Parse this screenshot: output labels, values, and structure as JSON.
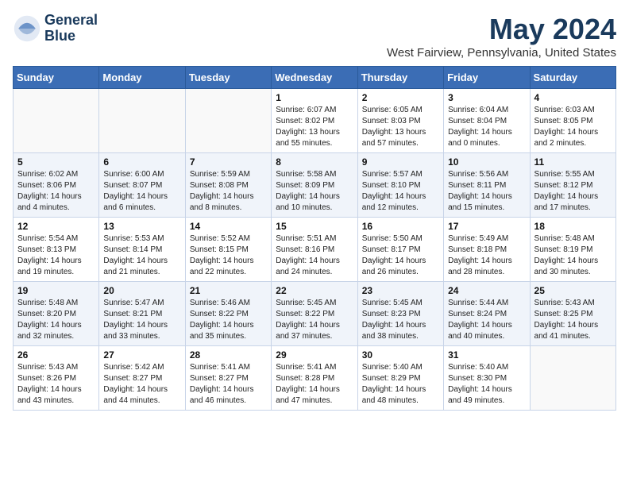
{
  "header": {
    "logo_line1": "General",
    "logo_line2": "Blue",
    "month_year": "May 2024",
    "location": "West Fairview, Pennsylvania, United States"
  },
  "days_of_week": [
    "Sunday",
    "Monday",
    "Tuesday",
    "Wednesday",
    "Thursday",
    "Friday",
    "Saturday"
  ],
  "weeks": [
    [
      {
        "day": "",
        "info": ""
      },
      {
        "day": "",
        "info": ""
      },
      {
        "day": "",
        "info": ""
      },
      {
        "day": "1",
        "info": "Sunrise: 6:07 AM\nSunset: 8:02 PM\nDaylight: 13 hours\nand 55 minutes."
      },
      {
        "day": "2",
        "info": "Sunrise: 6:05 AM\nSunset: 8:03 PM\nDaylight: 13 hours\nand 57 minutes."
      },
      {
        "day": "3",
        "info": "Sunrise: 6:04 AM\nSunset: 8:04 PM\nDaylight: 14 hours\nand 0 minutes."
      },
      {
        "day": "4",
        "info": "Sunrise: 6:03 AM\nSunset: 8:05 PM\nDaylight: 14 hours\nand 2 minutes."
      }
    ],
    [
      {
        "day": "5",
        "info": "Sunrise: 6:02 AM\nSunset: 8:06 PM\nDaylight: 14 hours\nand 4 minutes."
      },
      {
        "day": "6",
        "info": "Sunrise: 6:00 AM\nSunset: 8:07 PM\nDaylight: 14 hours\nand 6 minutes."
      },
      {
        "day": "7",
        "info": "Sunrise: 5:59 AM\nSunset: 8:08 PM\nDaylight: 14 hours\nand 8 minutes."
      },
      {
        "day": "8",
        "info": "Sunrise: 5:58 AM\nSunset: 8:09 PM\nDaylight: 14 hours\nand 10 minutes."
      },
      {
        "day": "9",
        "info": "Sunrise: 5:57 AM\nSunset: 8:10 PM\nDaylight: 14 hours\nand 12 minutes."
      },
      {
        "day": "10",
        "info": "Sunrise: 5:56 AM\nSunset: 8:11 PM\nDaylight: 14 hours\nand 15 minutes."
      },
      {
        "day": "11",
        "info": "Sunrise: 5:55 AM\nSunset: 8:12 PM\nDaylight: 14 hours\nand 17 minutes."
      }
    ],
    [
      {
        "day": "12",
        "info": "Sunrise: 5:54 AM\nSunset: 8:13 PM\nDaylight: 14 hours\nand 19 minutes."
      },
      {
        "day": "13",
        "info": "Sunrise: 5:53 AM\nSunset: 8:14 PM\nDaylight: 14 hours\nand 21 minutes."
      },
      {
        "day": "14",
        "info": "Sunrise: 5:52 AM\nSunset: 8:15 PM\nDaylight: 14 hours\nand 22 minutes."
      },
      {
        "day": "15",
        "info": "Sunrise: 5:51 AM\nSunset: 8:16 PM\nDaylight: 14 hours\nand 24 minutes."
      },
      {
        "day": "16",
        "info": "Sunrise: 5:50 AM\nSunset: 8:17 PM\nDaylight: 14 hours\nand 26 minutes."
      },
      {
        "day": "17",
        "info": "Sunrise: 5:49 AM\nSunset: 8:18 PM\nDaylight: 14 hours\nand 28 minutes."
      },
      {
        "day": "18",
        "info": "Sunrise: 5:48 AM\nSunset: 8:19 PM\nDaylight: 14 hours\nand 30 minutes."
      }
    ],
    [
      {
        "day": "19",
        "info": "Sunrise: 5:48 AM\nSunset: 8:20 PM\nDaylight: 14 hours\nand 32 minutes."
      },
      {
        "day": "20",
        "info": "Sunrise: 5:47 AM\nSunset: 8:21 PM\nDaylight: 14 hours\nand 33 minutes."
      },
      {
        "day": "21",
        "info": "Sunrise: 5:46 AM\nSunset: 8:22 PM\nDaylight: 14 hours\nand 35 minutes."
      },
      {
        "day": "22",
        "info": "Sunrise: 5:45 AM\nSunset: 8:22 PM\nDaylight: 14 hours\nand 37 minutes."
      },
      {
        "day": "23",
        "info": "Sunrise: 5:45 AM\nSunset: 8:23 PM\nDaylight: 14 hours\nand 38 minutes."
      },
      {
        "day": "24",
        "info": "Sunrise: 5:44 AM\nSunset: 8:24 PM\nDaylight: 14 hours\nand 40 minutes."
      },
      {
        "day": "25",
        "info": "Sunrise: 5:43 AM\nSunset: 8:25 PM\nDaylight: 14 hours\nand 41 minutes."
      }
    ],
    [
      {
        "day": "26",
        "info": "Sunrise: 5:43 AM\nSunset: 8:26 PM\nDaylight: 14 hours\nand 43 minutes."
      },
      {
        "day": "27",
        "info": "Sunrise: 5:42 AM\nSunset: 8:27 PM\nDaylight: 14 hours\nand 44 minutes."
      },
      {
        "day": "28",
        "info": "Sunrise: 5:41 AM\nSunset: 8:27 PM\nDaylight: 14 hours\nand 46 minutes."
      },
      {
        "day": "29",
        "info": "Sunrise: 5:41 AM\nSunset: 8:28 PM\nDaylight: 14 hours\nand 47 minutes."
      },
      {
        "day": "30",
        "info": "Sunrise: 5:40 AM\nSunset: 8:29 PM\nDaylight: 14 hours\nand 48 minutes."
      },
      {
        "day": "31",
        "info": "Sunrise: 5:40 AM\nSunset: 8:30 PM\nDaylight: 14 hours\nand 49 minutes."
      },
      {
        "day": "",
        "info": ""
      }
    ]
  ]
}
